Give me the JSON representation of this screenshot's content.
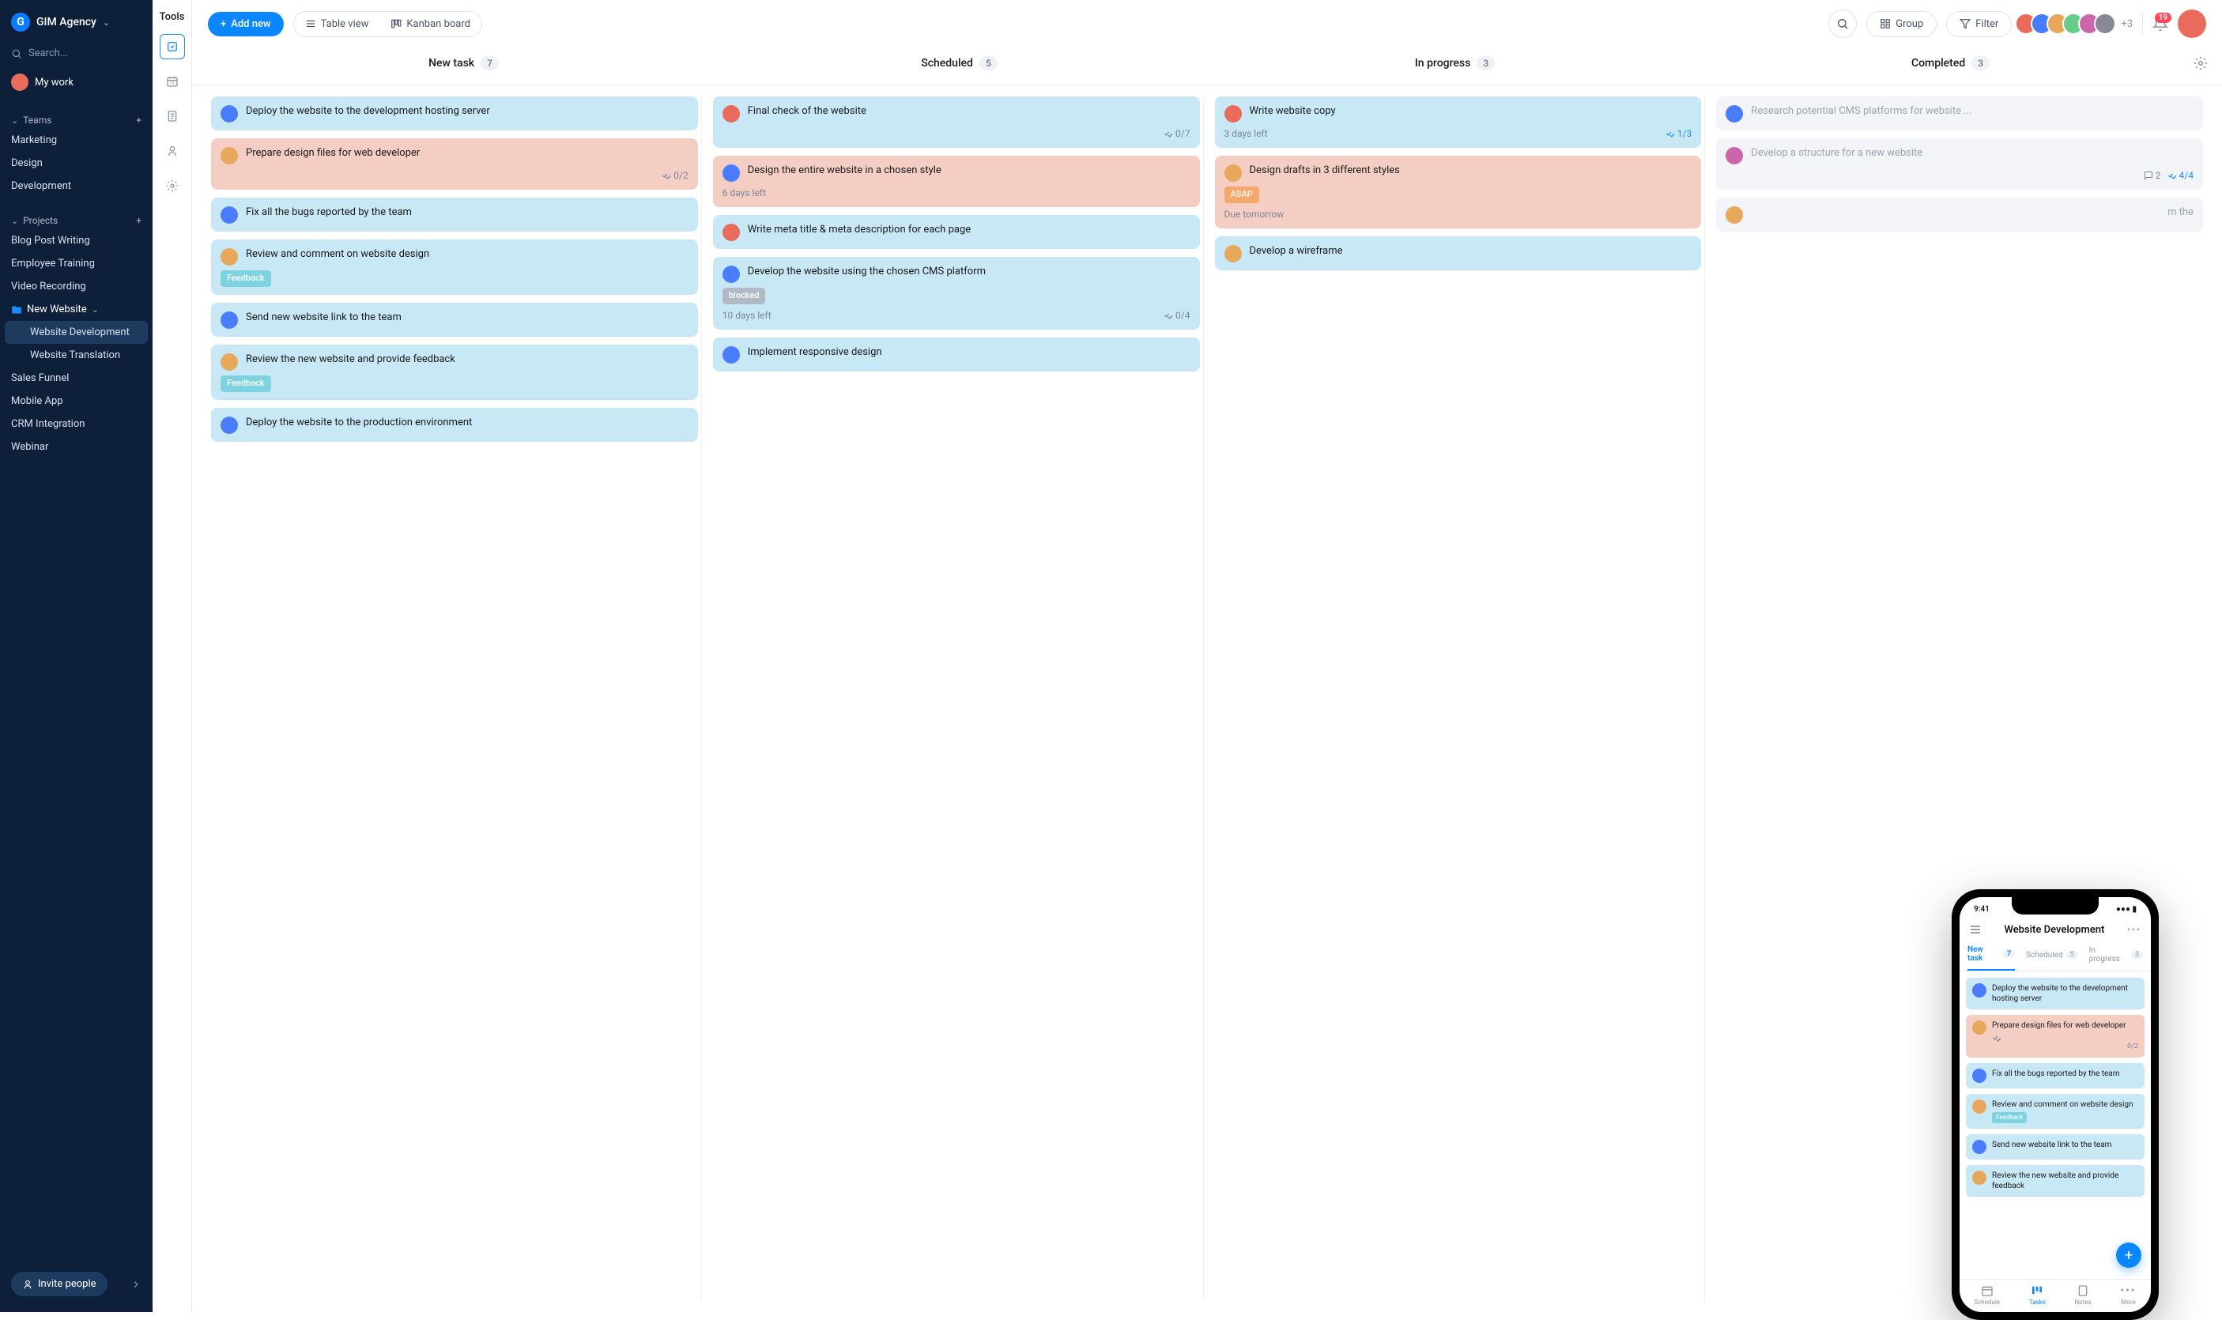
{
  "brand": {
    "logo_letter": "G",
    "name": "GIM Agency"
  },
  "search_placeholder": "Search...",
  "my_work_label": "My work",
  "teams": {
    "header": "Teams",
    "items": [
      "Marketing",
      "Design",
      "Development"
    ]
  },
  "projects": {
    "header": "Projects",
    "items_top": [
      "Blog Post Writing",
      "Employee Training",
      "Video Recording"
    ],
    "expanded": {
      "name": "New Website",
      "children": [
        "Website Development",
        "Website Translation"
      ],
      "active": "Website Development"
    },
    "items_bottom": [
      "Sales Funnel",
      "Mobile App",
      "CRM Integration",
      "Webinar"
    ]
  },
  "invite_label": "Invite people",
  "toolrail_label": "Tools",
  "topbar": {
    "add_new": "Add new",
    "table_view": "Table view",
    "kanban_board": "Kanban board",
    "group": "Group",
    "filter": "Filter",
    "plus_count": "+3",
    "notif_count": "19"
  },
  "columns": [
    {
      "title": "New task",
      "count": "7"
    },
    {
      "title": "Scheduled",
      "count": "5"
    },
    {
      "title": "In progress",
      "count": "3"
    },
    {
      "title": "Completed",
      "count": "3"
    }
  ],
  "cards": {
    "new_task": [
      {
        "title": "Deploy the website to the development hosting server",
        "color": "blue",
        "av": "av2"
      },
      {
        "title": "Prepare design files for web developer",
        "color": "salmon",
        "av": "av3",
        "frac": "0/2"
      },
      {
        "title": "Fix all the bugs reported by the team",
        "color": "blue",
        "av": "av2"
      },
      {
        "title": "Review and comment on website design",
        "color": "blue",
        "av": "av3",
        "tag": "Feedback"
      },
      {
        "title": "Send new website link to the team",
        "color": "blue",
        "av": "av2"
      },
      {
        "title": "Review the new website and provide feedback",
        "color": "blue",
        "av": "av3",
        "tag": "Feedback"
      },
      {
        "title": "Deploy the website to the production environment",
        "color": "blue",
        "av": "av2"
      }
    ],
    "scheduled": [
      {
        "title": "Final check of the website",
        "color": "blue",
        "av": "av1",
        "frac": "0/7"
      },
      {
        "title": "Design the entire website in a chosen style",
        "color": "salmon",
        "av": "av2",
        "due": "6 days left"
      },
      {
        "title": "Write meta title & meta description for each page",
        "color": "blue",
        "av": "av1"
      },
      {
        "title": "Develop the website using the chosen CMS platform",
        "color": "blue",
        "av": "av2",
        "tag": "blocked",
        "tag_color": "gray",
        "due": "10 days left",
        "frac": "0/4"
      },
      {
        "title": "Implement responsive design",
        "color": "blue",
        "av": "av2"
      }
    ],
    "in_progress": [
      {
        "title": "Write website copy",
        "color": "blue",
        "av": "av1",
        "due": "3 days left",
        "frac": "1/3",
        "frac_done": true
      },
      {
        "title": "Design drafts in 3 different styles",
        "color": "salmon",
        "av": "av3",
        "tag": "ASAP",
        "tag_color": "orange",
        "due": "Due tomorrow"
      },
      {
        "title": "Develop a wireframe",
        "color": "blue",
        "av": "av3"
      }
    ],
    "completed": [
      {
        "title": "Research potential CMS platforms for website ...",
        "color": "gray",
        "av": "av2",
        "faded": true
      },
      {
        "title": "Develop a structure for a new website",
        "color": "gray",
        "av": "av5",
        "faded": true,
        "comments": "2",
        "frac": "4/4",
        "frac_done": true
      },
      {
        "title_partial": "m the",
        "color": "gray",
        "av": "av3",
        "faded": true
      }
    ]
  },
  "phone": {
    "time": "9:41",
    "title": "Website Development",
    "tabs": [
      {
        "label": "New task",
        "count": "7"
      },
      {
        "label": "Scheduled",
        "count": "5"
      },
      {
        "label": "In progress",
        "count": "3"
      }
    ],
    "cards": [
      {
        "title": "Deploy the website to the development hosting server",
        "color": "blue",
        "av": "av2"
      },
      {
        "title": "Prepare design files for web developer",
        "color": "salmon",
        "av": "av3",
        "frac": "0/2"
      },
      {
        "title": "Fix all the bugs reported by the team",
        "color": "blue",
        "av": "av2"
      },
      {
        "title": "Review and comment on website design",
        "color": "blue",
        "av": "av3",
        "tag": "Feedback"
      },
      {
        "title": "Send new website link to the team",
        "color": "blue",
        "av": "av2"
      },
      {
        "title": "Review the new website and provide feedback",
        "color": "blue",
        "av": "av3"
      }
    ],
    "nav": [
      "Schedule",
      "Tasks",
      "Notes",
      "More"
    ]
  }
}
